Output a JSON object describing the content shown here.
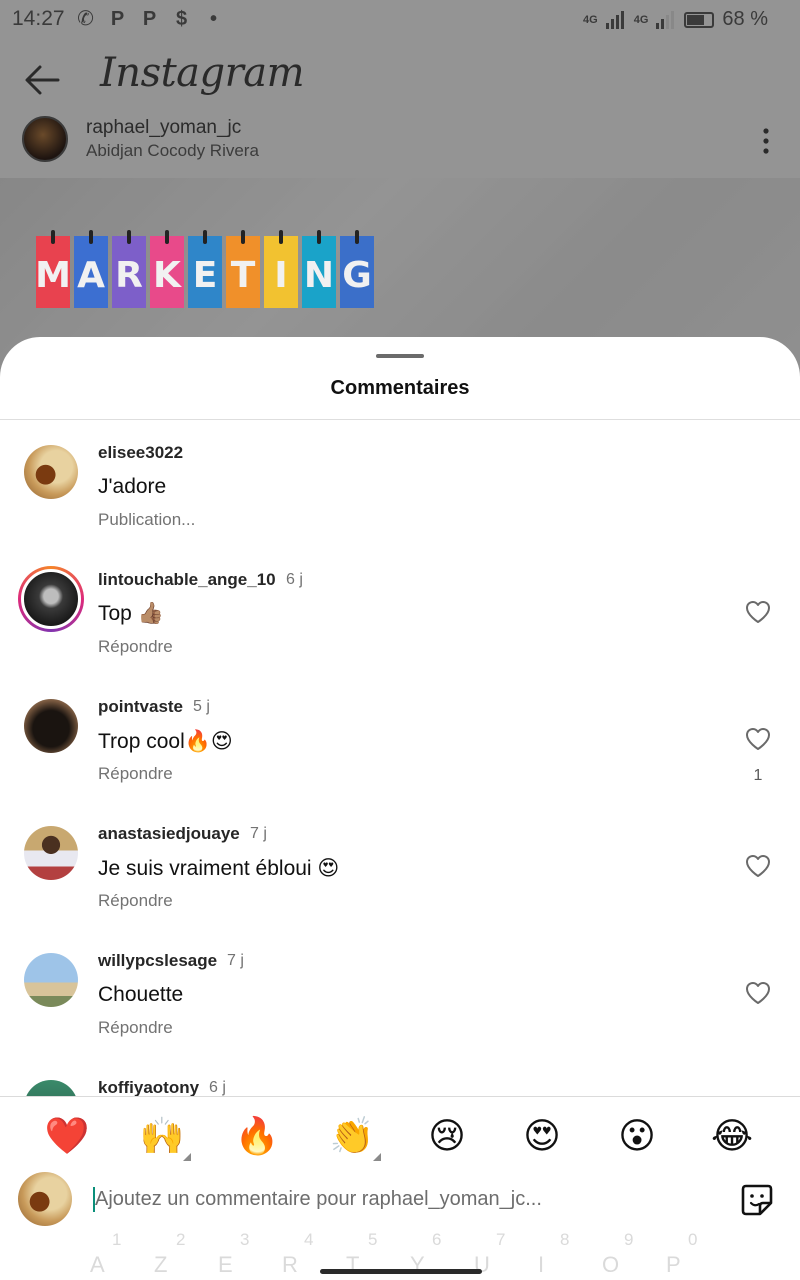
{
  "status_bar": {
    "time": "14:27",
    "notification_icons": [
      "whatsapp-icon",
      "paypal-icon",
      "paypal-icon",
      "cash-icon",
      "dot-icon"
    ],
    "network_1": "4G",
    "network_2": "4G",
    "battery_text": "68 %",
    "battery_level": 0.68
  },
  "header": {
    "app_title": "Instagram",
    "back_icon": "arrow-left-icon"
  },
  "post": {
    "username": "raphael_yoman_jc",
    "location": "Abidjan Cocody Rivera",
    "image_letters": [
      "M",
      "A",
      "R",
      "K",
      "E",
      "T",
      "I",
      "N",
      "G"
    ],
    "letter_colors": [
      "#e8424f",
      "#3c6fd1",
      "#7d5fc9",
      "#e84a8a",
      "#2f86c9",
      "#f0902a",
      "#f2c230",
      "#1aa3c9",
      "#3b6fc9"
    ]
  },
  "sheet": {
    "title": "Commentaires"
  },
  "comments": [
    {
      "username": "elisee3022",
      "time": "",
      "text": "J'adore",
      "action": "Publication...",
      "likes": "",
      "avatar": "food",
      "has_heart": false
    },
    {
      "username": "lintouchable_ange_10",
      "time": "6 j",
      "text": "Top 👍🏽",
      "action": "Répondre",
      "likes": "",
      "avatar": "ring",
      "has_heart": true
    },
    {
      "username": "pointvaste",
      "time": "5 j",
      "text": "Trop cool🔥😍",
      "action": "Répondre",
      "likes": "1",
      "avatar": "hair",
      "has_heart": true
    },
    {
      "username": "anastasiedjouaye",
      "time": "7 j",
      "text": "Je suis vraiment ébloui 😍",
      "action": "Répondre",
      "likes": "",
      "avatar": "man",
      "has_heart": true
    },
    {
      "username": "willypcslesage",
      "time": "7 j",
      "text": "Chouette",
      "action": "Répondre",
      "likes": "",
      "avatar": "beach",
      "has_heart": true
    },
    {
      "username": "koffiyaotony",
      "time": "6 j",
      "text": "",
      "action": "",
      "likes": "",
      "avatar": "green",
      "has_heart": false
    }
  ],
  "emoji_bar": [
    "❤️",
    "🙌",
    "🔥",
    "👏",
    "😢",
    "😍",
    "😮",
    "😂"
  ],
  "composer": {
    "placeholder": "Ajoutez un commentaire pour raphael_yoman_jc...",
    "value": ""
  },
  "keyboard_ghost": {
    "row1": [
      "1",
      "2",
      "3",
      "4",
      "5",
      "6",
      "7",
      "8",
      "9",
      "0"
    ],
    "row2": [
      "A",
      "Z",
      "E",
      "R",
      "T",
      "Y",
      "U",
      "I",
      "O",
      "P"
    ]
  }
}
